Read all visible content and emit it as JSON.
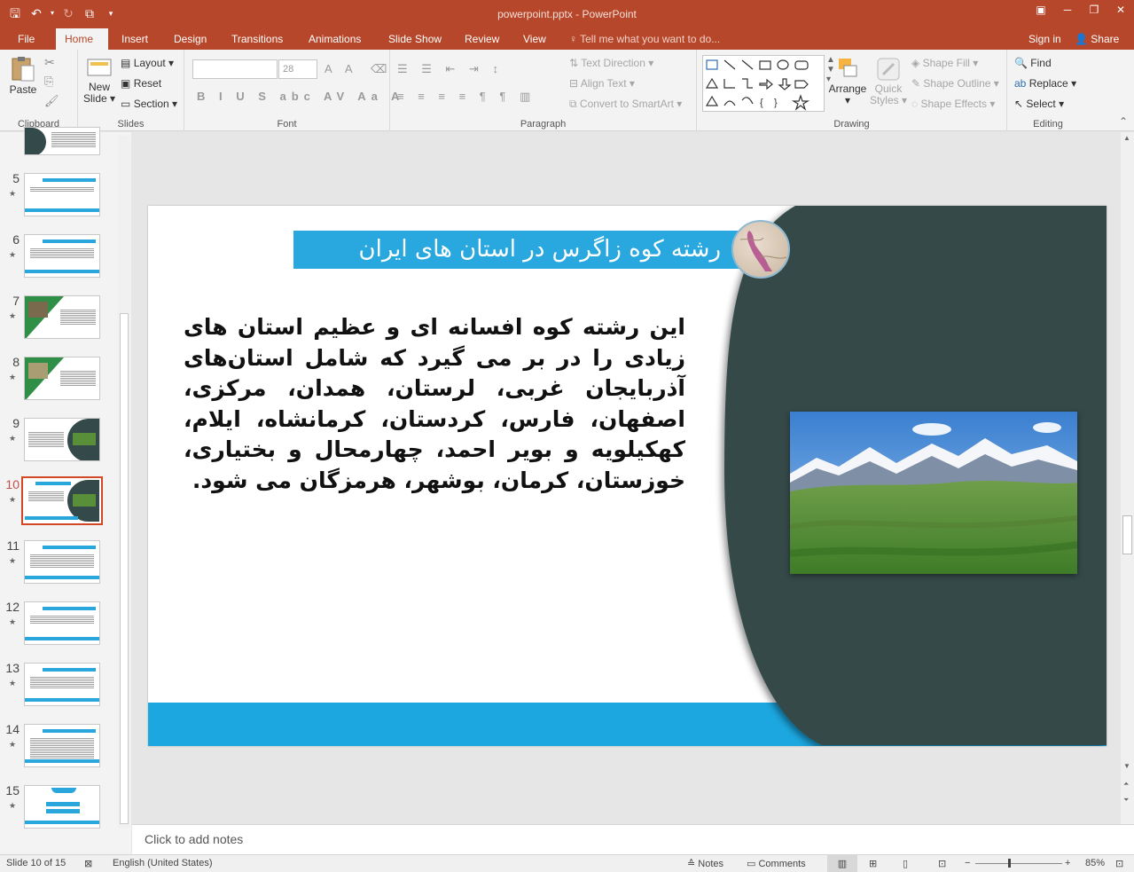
{
  "titlebar": {
    "doc_title": "powerpoint.pptx - PowerPoint",
    "qat_icons": [
      "save-icon",
      "undo-icon",
      "redo-icon",
      "present-icon",
      "customize-icon"
    ]
  },
  "tabs": [
    "File",
    "Home",
    "Insert",
    "Design",
    "Transitions",
    "Animations",
    "Slide Show",
    "Review",
    "View"
  ],
  "tell_me": "Tell me what you want to do...",
  "sign_in": "Sign in",
  "share": "Share",
  "ribbon": {
    "clipboard": {
      "label": "Clipboard",
      "paste": "Paste"
    },
    "slides": {
      "label": "Slides",
      "new_slide_1": "New",
      "new_slide_2": "Slide",
      "layout": "Layout",
      "reset": "Reset",
      "section": "Section"
    },
    "font": {
      "label": "Font",
      "font_size": "28"
    },
    "paragraph": {
      "label": "Paragraph",
      "text_direction": "Text Direction",
      "align_text": "Align Text",
      "convert_smartart": "Convert to SmartArt"
    },
    "drawing": {
      "label": "Drawing",
      "arrange": "Arrange",
      "quick_styles_1": "Quick",
      "quick_styles_2": "Styles",
      "shape_fill": "Shape Fill",
      "shape_outline": "Shape Outline",
      "shape_effects": "Shape Effects"
    },
    "editing": {
      "label": "Editing",
      "find": "Find",
      "replace": "Replace",
      "select": "Select"
    }
  },
  "thumbnails": [
    {
      "num": "5"
    },
    {
      "num": "6"
    },
    {
      "num": "7"
    },
    {
      "num": "8"
    },
    {
      "num": "9"
    },
    {
      "num": "10"
    },
    {
      "num": "11"
    },
    {
      "num": "12"
    },
    {
      "num": "13"
    },
    {
      "num": "14"
    },
    {
      "num": "15"
    }
  ],
  "slide": {
    "title": "رشته کوه زاگرس در استان های ایران",
    "body": "این رشته کوه افسانه ای و عظیم استان های زیادی را در بر می گیرد که شامل استان‌های آذربایجان غربی، لرستان، همدان، مرکزی، اصفهان، فارس، کردستان، کرمانشاه، ایلام، کهکیلویه و بویر احمد، چهارمحال و بختیاری، خوزستان، کرمان، بوشهر، هرمزگان می شود.",
    "colors": {
      "accent_blue": "#29a7df",
      "dark_panel": "#34494a"
    }
  },
  "notes_placeholder": "Click to add notes",
  "status": {
    "slide_counter": "Slide 10 of 15",
    "language": "English (United States)",
    "notes": "Notes",
    "comments": "Comments",
    "zoom": "85%"
  }
}
